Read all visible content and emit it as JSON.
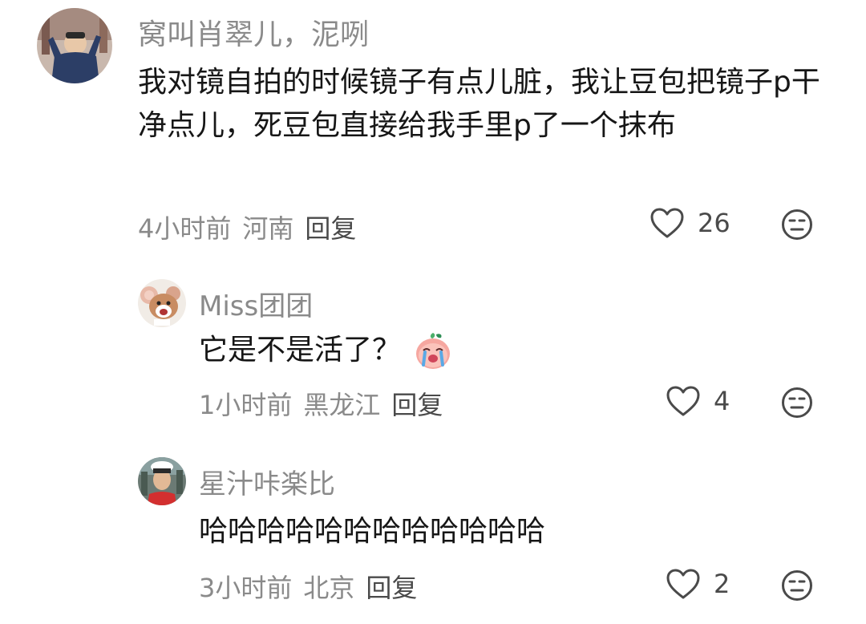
{
  "comments": [
    {
      "username": "窝叫肖翠儿，泥咧",
      "text": "我对镜自拍的时候镜子有点儿脏，我让豆包把镜子p干净点儿，死豆包直接给我手里p了一个抹布",
      "time": "4小时前",
      "location": "河南",
      "reply_label": "回复",
      "likes": "26",
      "avatar": "person-photo"
    },
    {
      "username": "Miss团团",
      "text": "它是不是活了？",
      "text_emoji": "crying-peach-sticker",
      "time": "1小时前",
      "location": "黑龙江",
      "reply_label": "回复",
      "likes": "4",
      "avatar": "cartoon-mouse"
    },
    {
      "username": "星汁咔楽比",
      "text": "哈哈哈哈哈哈哈哈哈哈哈哈",
      "time": "3小时前",
      "location": "北京",
      "reply_label": "回复",
      "likes": "2",
      "avatar": "person-photo"
    }
  ],
  "icons": {
    "like": "heart-outline-icon",
    "dislike": "meh-face-icon"
  },
  "colors": {
    "text": "#161616",
    "secondary": "#8a8a8a",
    "icon": "#4a4a4a"
  }
}
